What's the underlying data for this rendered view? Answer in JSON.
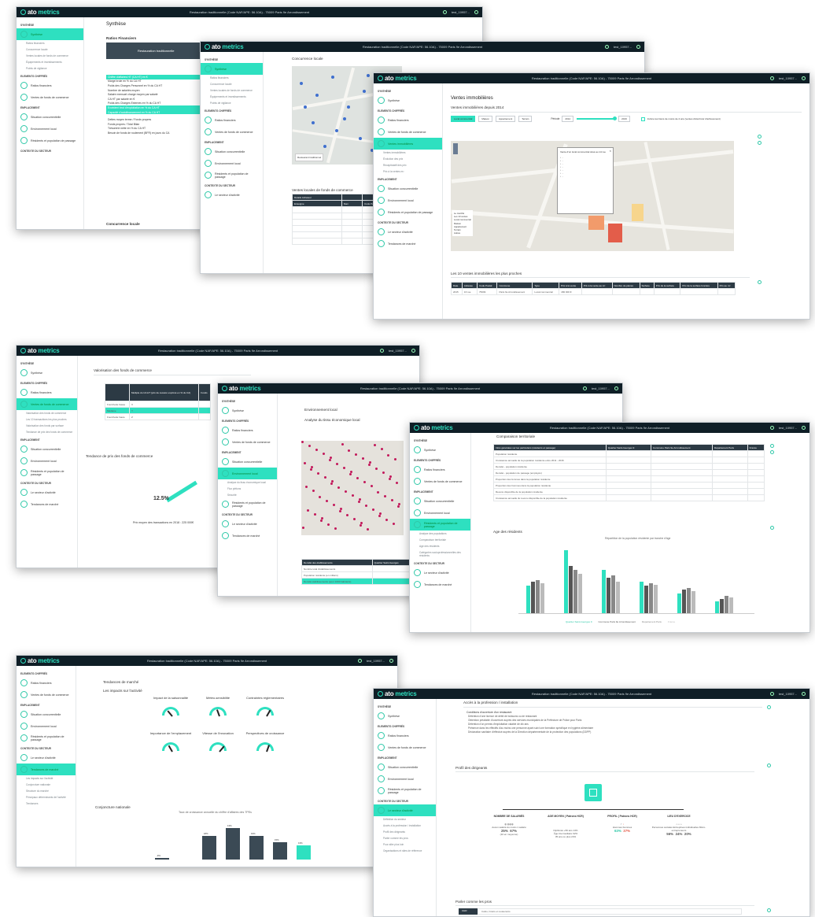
{
  "app": {
    "logo_prefix": "ato",
    "logo_suffix": "metrics",
    "title": "Restauration traditionnelle (Code NAF/APE: 56.10A) - 75009 Paris 9e Arrondissement",
    "user": "test_10957..."
  },
  "sidebar": {
    "sections": [
      "SYNTHÈSE",
      "ELEMENTS CHIFFRÉS",
      "EMPLACEMENT",
      "CONTEXTE DU SECTEUR"
    ],
    "synthese": "Synthèse",
    "sub1": [
      "Ratios financiers",
      "Concurrence locale",
      "Ventes locales de fonds de commerce",
      "Équipements et investissements",
      "Points de vigilance"
    ],
    "ratios": "Ratios financiers",
    "ventes": "Ventes de fonds de commerce",
    "concurrence": "Situation concurrentielle",
    "environnement": "Environnement local",
    "residents": "Résidents et population de passage",
    "secteur": "Le secteur d'activité",
    "tendances": "Tendances de marché",
    "immo": "Ventes immobilières",
    "sub_immo": [
      "Ventes immobilières",
      "Évolution des prix",
      "Recapitulatif des prix",
      "Prix à la ventes m²"
    ],
    "sub_ventes": [
      "Valorisation des fonds de commerce",
      "Les 10 transactions les plus proches",
      "Valorisation des fonds par surface",
      "Tendance de prix des fonds de commerce"
    ],
    "sub_env": [
      "Analyse du tissu économique local",
      "Flux piétons",
      "Sécurité"
    ],
    "sub_res": [
      "Analyse des populations",
      "Comparaison territoriale",
      "Age des résidents",
      "Catégories socioprofessionnelles des résidents"
    ],
    "sub_tend": [
      "Les impacts sur l'activité",
      "Conjoncture nationale",
      "Structure du marché",
      "Principaux déterminants de l'activité",
      "Tendances"
    ],
    "sub_sect": [
      "Définition du secteur",
      "Accès à la profession / installation",
      "Profil des dirigeants",
      "Parler comme les pros",
      "Pour aller plus loin",
      "Organisations et sites de référence"
    ]
  },
  "s1": {
    "title": "Synthèse",
    "section": "Ratios Financiers",
    "table_head": "Restauration traditionnelle",
    "rows": [
      "Chiffre d'affaires HT (CA HT) en €",
      "Marge brute en % du CA HT",
      "Poids des Charges Personnel en % du CA HT",
      "Nombre de salariés moyen",
      "Salaire mensuel charge moyen par salarié",
      "CA HT par salarié en €",
      "Poids des Charges Externes en % du CA HT",
      "Excédent brut d'exploitation en % du CA HT",
      "Capacité d'autofinancement en % du CA HT",
      "Dettes moyen terme / Fonds propres",
      "Fonds propres / Total Bilan",
      "Trésorerie nette en % du CA HT",
      "Besoin de fonds de roulement (BFR) en jours du CA"
    ],
    "next": "Concurrence locale"
  },
  "s2": {
    "title": "Concurrence locale",
    "table_title": "Ventes locales de fonds de commerce",
    "headers": [
      "Détails Acheteur",
      "Enseigne",
      "Nom",
      "Code Postal"
    ],
    "legend": "Restaurant traditionnel"
  },
  "s3": {
    "title": "Ventes immobilières",
    "subtitle": "Ventes immobilières depuis 2014",
    "filters": [
      "Local commercial",
      "Maison",
      "Appartement",
      "Terrain"
    ],
    "periode": "Période",
    "year_from": "2014",
    "year_to": "2019",
    "note": "Inclure les biens de moins de 2 ans (ventes d'état futur d'achèvement)",
    "popup_title": "Vente d'un local commercial situé au 14 rue",
    "table_title": "Les 10 ventes immobilières les plus proches",
    "headers": [
      "Date",
      "Adresse",
      "Code Postal",
      "Commune",
      "Type",
      "Prix à la vente",
      "Prix à la vente au m²",
      "Nombre de pièces",
      "Surface",
      "Prix de la surface",
      "Prix de la surface foncière",
      "Prix au m²"
    ],
    "row": [
      "2015",
      "16 rue",
      "75009",
      "Paris 9e Arrondissement",
      "Local commercial",
      "180 000 €",
      "",
      "",
      "",
      "",
      "",
      ""
    ],
    "legend": [
      "Le marché",
      "Les 10 ventes",
      "Local commercial",
      "Maison",
      "Appartement",
      "Terrain",
      "Autres"
    ]
  },
  "s4": {
    "title": "Valorisation des fonds de commerce",
    "col1": "Multiple du CA HT (prix de cession exprimé en % du CA)",
    "col2": "Fonds",
    "rows": [
      [
        "Fourchette basse",
        "X"
      ],
      [
        "Médiane",
        "Y"
      ],
      [
        "Fourchette haute",
        "Z"
      ]
    ],
    "trend_title": "Tendance de prix des fonds de commerce",
    "trend_sub": "Prix moyen des transactions en 2018 : 225 000€",
    "trend_value": "12.5%"
  },
  "s5": {
    "title": "Environnement local",
    "section": "Analyse du tissu économique local",
    "table_headers": [
      "Densité des établissements",
      "Quartier Saint-Georges"
    ],
    "rows": [
      "Nombre total d'établissements",
      "Population résidente (en milliers)",
      "Densité établissements (pour 1000 habitants)"
    ]
  },
  "s6": {
    "title": "Comparaison territoriale",
    "headers": [
      "Infos générales sur les particuliers (résidents et passage)",
      "Quartier Saint-Georges 9",
      "Commune Paris 9e Arrondissement",
      "Département Paris",
      "France"
    ],
    "rows": [
      "Population résidente",
      "Croissance annuelle de la population résidente entre 2011 - 2016",
      "Densité - population résidente",
      "Densité - population de passage (employés)",
      "Proportion des femmes dans la population résidente",
      "Proportion des hommes dans la population résidente",
      "Revenu disponible de la population résidente",
      "Croissance annuelle du revenu disponible de la population résidente"
    ],
    "chart_title": "Age des résidents",
    "chart_sub": "Répartition de la population résidente par tranche d'âge",
    "legend": [
      "Quartier Saint-Georges 9",
      "Commune Paris 9e Arrondissement",
      "Département Paris",
      "France"
    ]
  },
  "s7": {
    "title": "Tendances de marché",
    "section": "Les impacts sur l'activité",
    "gauges": [
      "Impact de la saisonnalité",
      "Météo-sensibilité",
      "Contraintes réglementaires",
      "Importance de l'emplacement",
      "Vitesse de l'innovation",
      "Perspectives de croissance"
    ],
    "conj": "Conjoncture nationale",
    "conj_sub": "Taux de croissance annuelle du chiffre d'affaires des TPEs",
    "bar_labels": [
      "-9%",
      "",
      "18%",
      "13%",
      "19%",
      "15%",
      "13%"
    ]
  },
  "s8": {
    "title": "Accès à la profession / installation",
    "conditions": "Conditions d'ouverture d'un restaurant",
    "bullets": [
      "Détention d'une licence de débit de boissons ou de restaurant",
      "Obtention préalable d'ouverture auprès des services municipales de la Préfecture de Police pour Paris",
      "Détention d'un permis d'exploitation valable de dix ans",
      "Présence dans les effectifs d'au moins une personne ayant suivi une formation spécifique en hygiène alimentaire",
      "Déclaration sanitaire d'effectué auprès de la Direction départementale de la protection des populations (DDPP)"
    ],
    "profil": "Profil des dirigeants",
    "cols": [
      "NOMBRE DE SALARIÉS",
      "AGE MOYEN ( Patrons HCR)",
      "PROFIL ( Patrons HCR)",
      "LIEU D'EXERCICE"
    ],
    "salaries": [
      "25%",
      "67%"
    ],
    "salaries_lbl": [
      "Aucun salarié",
      "Au moins 1 salarié",
      "(10 en moyenne)"
    ],
    "age": [
      "Diplômés +50 ans 14%",
      "Âge intermédiaire 62%",
      "35 ans ou plus 24%"
    ],
    "profil_vals": [
      "63%",
      "37%"
    ],
    "profil_lbl": [
      "Hommes",
      "Femmes"
    ],
    "lieu_vals": [
      "56%",
      "24%",
      "20%"
    ],
    "lieu_lbl": [
      "Personnes sociales",
      "Entreprises individuelles",
      "Micro-entrepreneurs"
    ],
    "parler": "Parler comme les pros",
    "chr": "CHR",
    "chr_def": "Cafés, hôtels et restaurants"
  }
}
